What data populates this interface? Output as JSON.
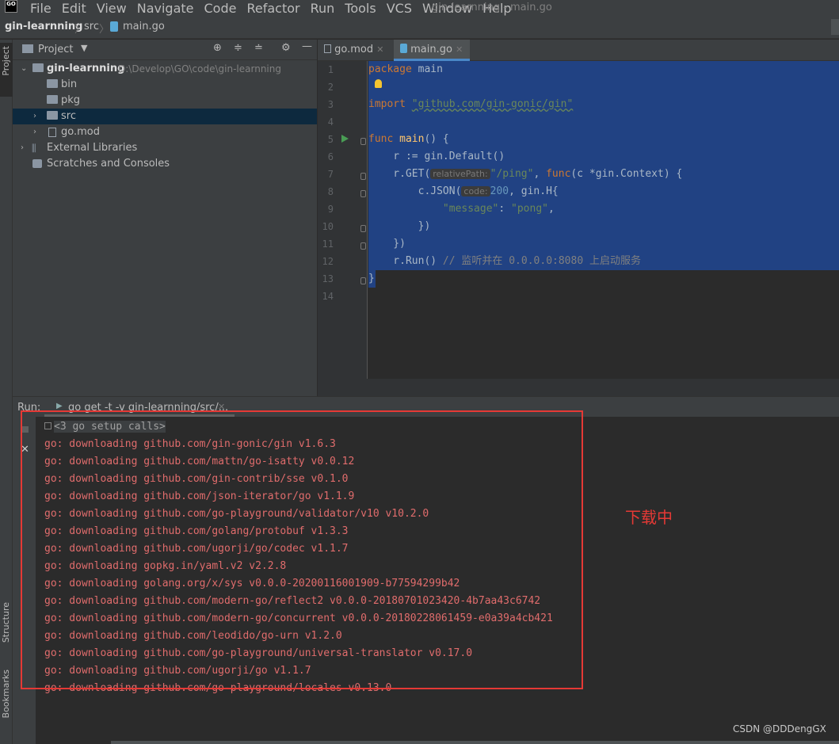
{
  "menu": {
    "logo_text": "GO",
    "items": [
      "File",
      "Edit",
      "View",
      "Navigate",
      "Code",
      "Refactor",
      "Run",
      "Tools",
      "VCS",
      "Window",
      "Help"
    ],
    "window_title": "gin-learnning - main.go"
  },
  "breadcrumb": {
    "project": "gin-learnning",
    "dir": "src",
    "file": "main.go"
  },
  "left_stripe": {
    "project": "Project",
    "structure": "Structure",
    "bookmarks": "Bookmarks"
  },
  "project_panel": {
    "title": "Project",
    "tree": [
      {
        "label": "gin-learnning",
        "path": "D:\\Develop\\GO\\code\\gin-learnning"
      },
      {
        "label": "bin"
      },
      {
        "label": "pkg"
      },
      {
        "label": "src"
      },
      {
        "label": "go.mod"
      },
      {
        "label": "External Libraries"
      },
      {
        "label": "Scratches and Consoles"
      }
    ]
  },
  "tabs": [
    {
      "label": "go.mod"
    },
    {
      "label": "main.go"
    }
  ],
  "code": {
    "line_numbers": [
      "1",
      "2",
      "3",
      "4",
      "5",
      "6",
      "7",
      "8",
      "9",
      "10",
      "11",
      "12",
      "13",
      "14"
    ],
    "l1_kw": "package",
    "l1_id": " main",
    "l3_kw": "import",
    "l3_str": "\"github.com/gin-gonic/gin\"",
    "l5_kw": "func",
    "l5_fn": " main",
    "l5_rest": "() {",
    "l6": "    r := gin.Default()",
    "l7_a": "    r.GET(",
    "l7_hint": "relativePath:",
    "l7_str": "\"/ping\"",
    "l7_b": ", ",
    "l7_kw": "func",
    "l7_c": "(c *gin.Context) {",
    "l8_a": "        c.JSON(",
    "l8_hint": "code:",
    "l8_num": "200",
    "l8_b": ", gin.H{",
    "l9_str1": "\"message\"",
    "l9_b": ": ",
    "l9_str2": "\"pong\"",
    "l9_c": ",",
    "l10": "        })",
    "l11": "    })",
    "l12_a": "    r.Run() ",
    "l12_cm": "// 监听并在 0.0.0.0:8080 上启动服务",
    "l13": "}"
  },
  "run": {
    "label": "Run:",
    "tab": "go get -t -v gin-learnning/src/...",
    "setup": "<3 go setup calls>",
    "lines": [
      "go: downloading github.com/gin-gonic/gin v1.6.3",
      "go: downloading github.com/mattn/go-isatty v0.0.12",
      "go: downloading github.com/gin-contrib/sse v0.1.0",
      "go: downloading github.com/json-iterator/go v1.1.9",
      "go: downloading github.com/go-playground/validator/v10 v10.2.0",
      "go: downloading github.com/golang/protobuf v1.3.3",
      "go: downloading github.com/ugorji/go/codec v1.1.7",
      "go: downloading gopkg.in/yaml.v2 v2.2.8",
      "go: downloading golang.org/x/sys v0.0.0-20200116001909-b77594299b42",
      "go: downloading github.com/modern-go/reflect2 v0.0.0-20180701023420-4b7aa43c6742",
      "go: downloading github.com/modern-go/concurrent v0.0.0-20180228061459-e0a39a4cb421",
      "go: downloading github.com/leodido/go-urn v1.2.0",
      "go: downloading github.com/go-playground/universal-translator v0.17.0",
      "go: downloading github.com/ugorji/go v1.1.7",
      "go: downloading github.com/go-playground/locales v0.13.0"
    ]
  },
  "annotation": "下载中",
  "watermark": "CSDN @DDDengGX"
}
